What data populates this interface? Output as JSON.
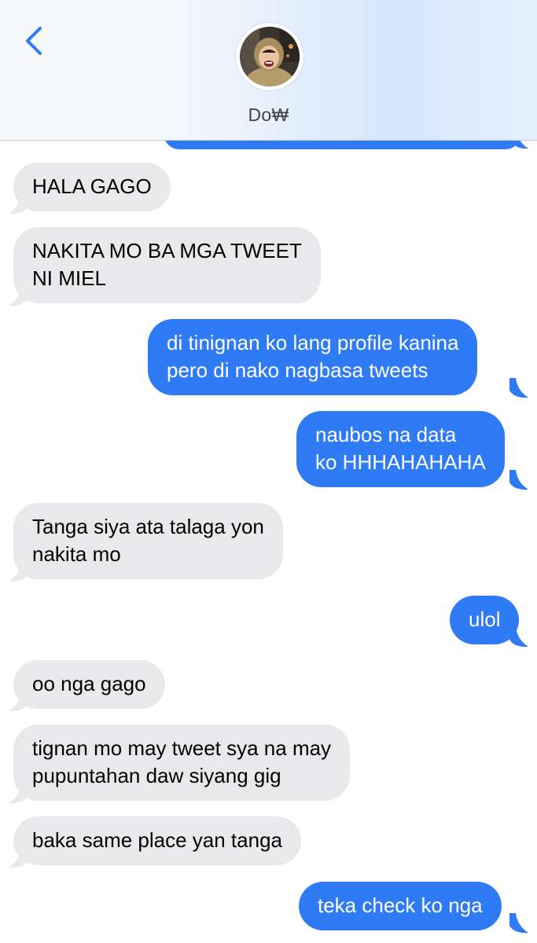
{
  "header": {
    "contact_name": "Do₩"
  },
  "messages": [
    {
      "dir": "in",
      "text": "HALA GAGO"
    },
    {
      "dir": "in",
      "text": "NAKITA MO BA MGA TWEET\nNI MIEL"
    },
    {
      "dir": "out",
      "text": "di tinignan ko lang profile kanina\npero di nako nagbasa tweets"
    },
    {
      "dir": "out",
      "text": "naubos na data\nko HHHAHAHAHA"
    },
    {
      "dir": "in",
      "text": "Tanga siya ata talaga yon\nnakita mo"
    },
    {
      "dir": "out",
      "text": "ulol"
    },
    {
      "dir": "in",
      "text": "oo nga gago"
    },
    {
      "dir": "in",
      "text": "tignan mo may tweet sya na may\npupuntahan daw siyang gig"
    },
    {
      "dir": "in",
      "text": "baka same place yan tanga"
    },
    {
      "dir": "out",
      "text": "teka check ko nga"
    }
  ],
  "colors": {
    "incoming_bubble": "#e9e9eb",
    "outgoing_bubble": "#2f7bf6",
    "accent": "#2f7bf6"
  }
}
